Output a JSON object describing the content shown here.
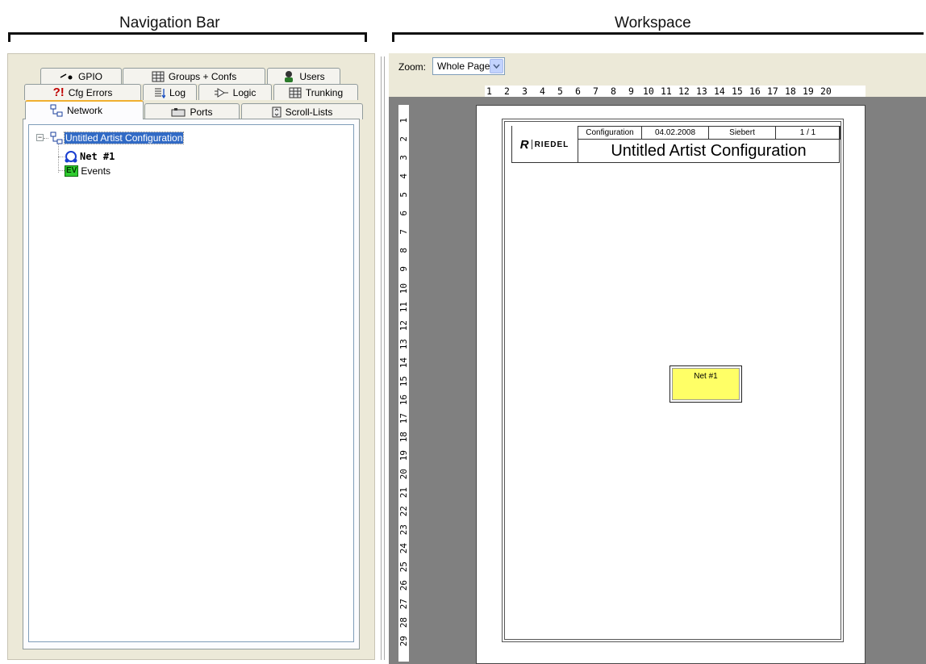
{
  "headers": {
    "navigation": "Navigation Bar",
    "workspace": "Workspace"
  },
  "tabs": {
    "row1": [
      {
        "label": "GPIO",
        "icon": "gpio-icon"
      },
      {
        "label": "Groups + Confs",
        "icon": "groups-icon"
      },
      {
        "label": "Users",
        "icon": "users-icon"
      }
    ],
    "row2": [
      {
        "label": "Cfg Errors",
        "icon": "cfg-errors-icon"
      },
      {
        "label": "Log",
        "icon": "log-icon"
      },
      {
        "label": "Logic",
        "icon": "logic-icon"
      },
      {
        "label": "Trunking",
        "icon": "trunking-icon"
      }
    ],
    "row3": [
      {
        "label": "Network",
        "icon": "network-icon",
        "active": true
      },
      {
        "label": "Ports",
        "icon": "ports-icon"
      },
      {
        "label": "Scroll-Lists",
        "icon": "scroll-lists-icon"
      }
    ],
    "cfg_errors_glyph": "?!"
  },
  "tree": {
    "root": "Untitled Artist Configuration",
    "children": [
      {
        "label": "Net #1",
        "icon": "net-icon"
      },
      {
        "label": "Events",
        "icon": "events-icon",
        "badge": "EV"
      }
    ],
    "expander": "−"
  },
  "workspace": {
    "zoom_label": "Zoom:",
    "zoom_value": "Whole Page",
    "hruler": [
      "1",
      "2",
      "3",
      "4",
      "5",
      "6",
      "7",
      "8",
      "9",
      "10",
      "11",
      "12",
      "13",
      "14",
      "15",
      "16",
      "17",
      "18",
      "19",
      "20"
    ],
    "vruler": [
      "1",
      "2",
      "3",
      "4",
      "5",
      "6",
      "7",
      "8",
      "9",
      "10",
      "11",
      "12",
      "13",
      "14",
      "15",
      "16",
      "17",
      "18",
      "19",
      "20",
      "21",
      "22",
      "23",
      "24",
      "25",
      "26",
      "27",
      "28",
      "29"
    ]
  },
  "document": {
    "logo": "RIEDEL",
    "logo_mark": "R",
    "type": "Configuration",
    "date": "04.02.2008",
    "author": "Siebert",
    "page": "1 / 1",
    "title": "Untitled Artist Configuration",
    "net_node": "Net #1"
  },
  "colors": {
    "selection": "#316ac5",
    "accent_tab": "#f0b030",
    "net_fill": "#ffff66",
    "canvas": "#808080"
  }
}
